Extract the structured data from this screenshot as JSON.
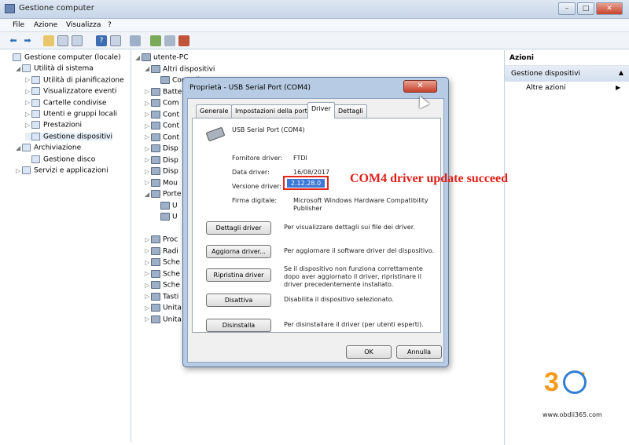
{
  "window": {
    "title": "Gestione computer",
    "controls": [
      "–",
      "□",
      "✕"
    ]
  },
  "menu": [
    "File",
    "Azione",
    "Visualizza",
    "?"
  ],
  "toolbar_icons": [
    "back-icon",
    "forward-icon",
    "up-icon",
    "show-hide-tree-icon",
    "properties-icon",
    "help-icon",
    "console-icon",
    "scan-hardware-icon",
    "update-driver-icon",
    "disable-icon",
    "uninstall-icon"
  ],
  "left_tree": [
    {
      "label": "Gestione computer (locale)",
      "level": 0,
      "expander": ""
    },
    {
      "label": "Utilità di sistema",
      "level": 1,
      "expander": "◢"
    },
    {
      "label": "Utilità di pianificazione",
      "level": 2,
      "expander": "▷"
    },
    {
      "label": "Visualizzatore eventi",
      "level": 2,
      "expander": "▷"
    },
    {
      "label": "Cartelle condivise",
      "level": 2,
      "expander": "▷"
    },
    {
      "label": "Utenti e gruppi locali",
      "level": 2,
      "expander": "▷"
    },
    {
      "label": "Prestazioni",
      "level": 2,
      "expander": "▷"
    },
    {
      "label": "Gestione dispositivi",
      "level": 2,
      "expander": "",
      "selected": true
    },
    {
      "label": "Archiviazione",
      "level": 1,
      "expander": "◢"
    },
    {
      "label": "Gestione disco",
      "level": 2,
      "expander": ""
    },
    {
      "label": "Servizi e applicazioni",
      "level": 1,
      "expander": "▷"
    }
  ],
  "device_tree": [
    {
      "label": "utente-PC",
      "level": 0,
      "expander": "◢"
    },
    {
      "label": "Altri dispositivi",
      "level": 1,
      "expander": "◢"
    },
    {
      "label": "Controller",
      "level": 2,
      "expander": ""
    },
    {
      "label": "Batte",
      "level": 1,
      "expander": "▷"
    },
    {
      "label": "Com",
      "level": 1,
      "expander": "▷"
    },
    {
      "label": "Cont",
      "level": 1,
      "expander": "▷"
    },
    {
      "label": "Cont",
      "level": 1,
      "expander": "▷"
    },
    {
      "label": "Cont",
      "level": 1,
      "expander": "▷"
    },
    {
      "label": "Disp",
      "level": 1,
      "expander": "▷"
    },
    {
      "label": "Disp",
      "level": 1,
      "expander": "▷"
    },
    {
      "label": "Disp",
      "level": 1,
      "expander": "▷"
    },
    {
      "label": "Mou",
      "level": 1,
      "expander": "▷"
    },
    {
      "label": "Porte",
      "level": 1,
      "expander": "◢"
    },
    {
      "label": "U",
      "level": 2,
      "expander": ""
    },
    {
      "label": "U",
      "level": 2,
      "expander": ""
    },
    {
      "label": "",
      "level": 0,
      "expander": ""
    },
    {
      "label": "Proc",
      "level": 1,
      "expander": "▷"
    },
    {
      "label": "Radi",
      "level": 1,
      "expander": "▷"
    },
    {
      "label": "Sche",
      "level": 1,
      "expander": "▷"
    },
    {
      "label": "Sche",
      "level": 1,
      "expander": "▷"
    },
    {
      "label": "Sche",
      "level": 1,
      "expander": "▷"
    },
    {
      "label": "Tasti",
      "level": 1,
      "expander": "▷"
    },
    {
      "label": "Unita",
      "level": 1,
      "expander": "▷"
    },
    {
      "label": "Unita",
      "level": 1,
      "expander": "▷"
    }
  ],
  "actions": {
    "header": "Azioni",
    "section": "Gestione dispositivi",
    "item": "Altre azioni"
  },
  "dialog": {
    "title": "Proprietà - USB Serial Port (COM4)",
    "tabs": [
      "Generale",
      "Impostazioni della porta",
      "Driver",
      "Dettagli"
    ],
    "active_tab": "Driver",
    "device_name": "USB Serial Port (COM4)",
    "fields": {
      "provider_label": "Fornitore driver:",
      "provider_value": "FTDI",
      "date_label": "Data driver:",
      "date_value": "16/08/2017",
      "version_label": "Versione driver:",
      "version_value": "2.12.28.0",
      "signer_label": "Firma digitale:",
      "signer_value": "Microsoft Windows Hardware Compatibility Publisher"
    },
    "buttons": [
      {
        "label": "Dettagli driver",
        "desc": "Per visualizzare dettagli sui file dei driver."
      },
      {
        "label": "Aggiorna driver...",
        "desc": "Per aggiornare il software driver del dispositivo."
      },
      {
        "label": "Ripristina driver",
        "desc": "Se il dispositivo non funziona correttamente dopo aver aggiornato il driver, ripristinare il driver precedentemente installato."
      },
      {
        "label": "Disattiva",
        "desc": "Disabilita il dispositivo selezionato."
      },
      {
        "label": "Disinstalla",
        "desc": "Per disinstallare il driver (per utenti esperti)."
      }
    ],
    "ok": "OK",
    "cancel": "Annulla"
  },
  "annotation": "COM4 driver update succeed",
  "watermark": {
    "logo": "3 5",
    "site": "www.obdii365.com"
  }
}
